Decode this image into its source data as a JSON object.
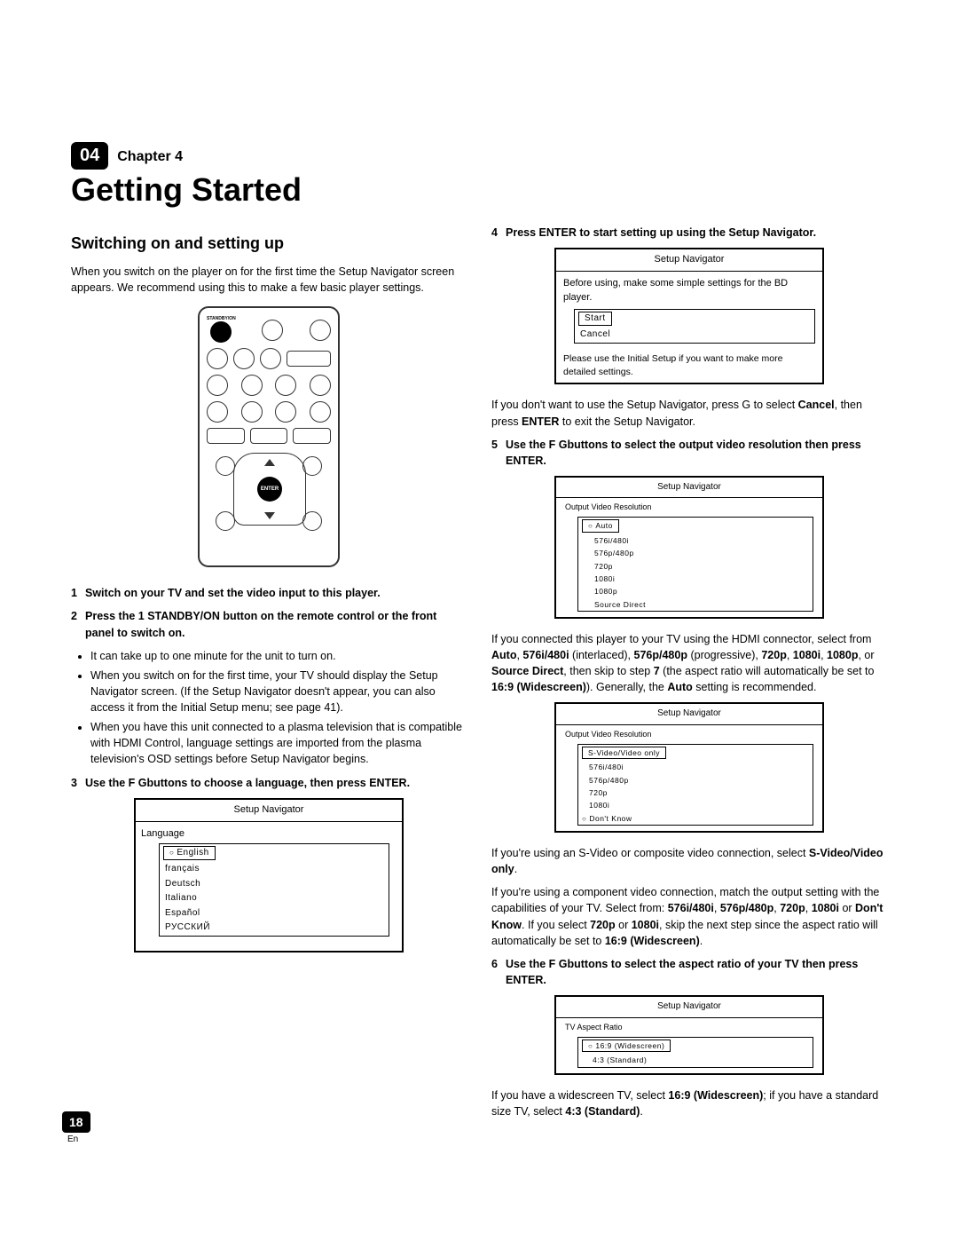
{
  "chapter": {
    "badge": "04",
    "label": "Chapter 4",
    "title": "Getting Started"
  },
  "section_title": "Switching on and setting up",
  "intro": "When you switch on the player on for the first time the Setup Navigator screen appears. We recommend using this to make a few basic player settings.",
  "remote": {
    "standby_label": "STANDBY/ON",
    "enter_label": "ENTER"
  },
  "steps_left": {
    "s1": "Switch on your TV and set the video input to this player.",
    "s2a": "Press the ",
    "s2icon": "1",
    "s2b": " STANDBY/ON button on the remote control or the front panel to switch on.",
    "bullets": [
      "It can take up to one minute for the unit to turn on.",
      "When you switch on for the first time, your TV should display the Setup Navigator screen. (If the Setup Navigator doesn't appear, you can also access it from the Initial Setup menu; see page 41).",
      "When you have this unit connected to a plasma television that is compatible with HDMI Control, language settings are imported from the plasma television's OSD settings before Setup Navigator begins."
    ],
    "s3a": "Use the ",
    "s3icons": "F  G",
    "s3b": "buttons to choose a language, then press ENTER."
  },
  "nav_language": {
    "title": "Setup Navigator",
    "section": "Language",
    "options": [
      "English",
      "français",
      "Deutsch",
      "Italiano",
      "Español",
      "РУССКИЙ"
    ],
    "selected": "English"
  },
  "steps_right": {
    "s4": "Press ENTER to start setting up using the Setup Navigator.",
    "nav_start": {
      "title": "Setup Navigator",
      "prompt": "Before using, make some simple settings for the BD player.",
      "options": [
        "Start",
        "Cancel"
      ],
      "selected": "Start",
      "hint": "Please use the Initial Setup if you want to make more detailed settings."
    },
    "after4a": "If you don't want to use the Setup Navigator, press  G to select ",
    "cancel_bold": "Cancel",
    "after4b": ", then press ",
    "enter_bold": "ENTER",
    "after4c": " to exit the Setup Navigator.",
    "s5a": "Use the ",
    "s5icons": "F  G",
    "s5b": "buttons to select the output video resolution then press ENTER.",
    "nav_res1": {
      "title": "Setup Navigator",
      "section": "Output Video Resolution",
      "options": [
        "Auto",
        "576i/480i",
        "576p/480p",
        "720p",
        "1080i",
        "1080p",
        "Source Direct"
      ],
      "selected": "Auto"
    },
    "after5_text": "If you connected this player to your TV using the HDMI connector, select from ",
    "after5_opts": [
      "Auto",
      "576i/480i",
      "576p/480p",
      "720p",
      "1080i",
      "1080p",
      "Source Direct"
    ],
    "after5_interlaced": " (interlaced), ",
    "after5_progressive": " (progressive), ",
    "after5_skip": ", then skip to step ",
    "after5_step": "7",
    "after5_tail": " (the aspect ratio will automatically be set to ",
    "after5_wide": "16:9 (Widescreen)",
    "after5_tail2": "). Generally, the ",
    "after5_auto": "Auto",
    "after5_tail3": " setting is recommended.",
    "nav_res2": {
      "title": "Setup Navigator",
      "section": "Output Video Resolution",
      "options": [
        "S-Video/Video only",
        "576i/480i",
        "576p/480p",
        "720p",
        "1080i",
        "Don't Know"
      ],
      "selected": "S-Video/Video only",
      "last_marker": "Don't Know"
    },
    "svideo_a": "If you're using an S-Video or composite video connection, select ",
    "svideo_b": "S-Video/Video only",
    "svideo_c": ".",
    "component_a": "If you're using a component video connection, match the output setting with the capabilities of your TV. Select from: ",
    "component_opts": [
      "576i/480i",
      "576p/480p",
      "720p",
      "1080i",
      "Don't Know"
    ],
    "component_if": ". If you select ",
    "component_720": "720p",
    "component_or": " or ",
    "component_1080": "1080i",
    "component_tail": ", skip the next step since the aspect ratio will automatically be set to ",
    "component_wide": "16:9 (Widescreen)",
    "component_tail2": ".",
    "s6a": "Use the ",
    "s6icons": "F  G",
    "s6b": "buttons to select the aspect ratio of your TV then press ENTER.",
    "nav_aspect": {
      "title": "Setup Navigator",
      "section": "TV Aspect Ratio",
      "options": [
        "16:9 (Widescreen)",
        "4:3 (Standard)"
      ],
      "selected": "16:9 (Widescreen)"
    },
    "aspect_a": "If you have a widescreen TV, select ",
    "aspect_wide": "16:9 (Widescreen)",
    "aspect_b": "; if you have a standard size TV, select ",
    "aspect_std": "4:3 (Standard)",
    "aspect_c": "."
  },
  "footer": {
    "page": "18",
    "lang": "En"
  }
}
